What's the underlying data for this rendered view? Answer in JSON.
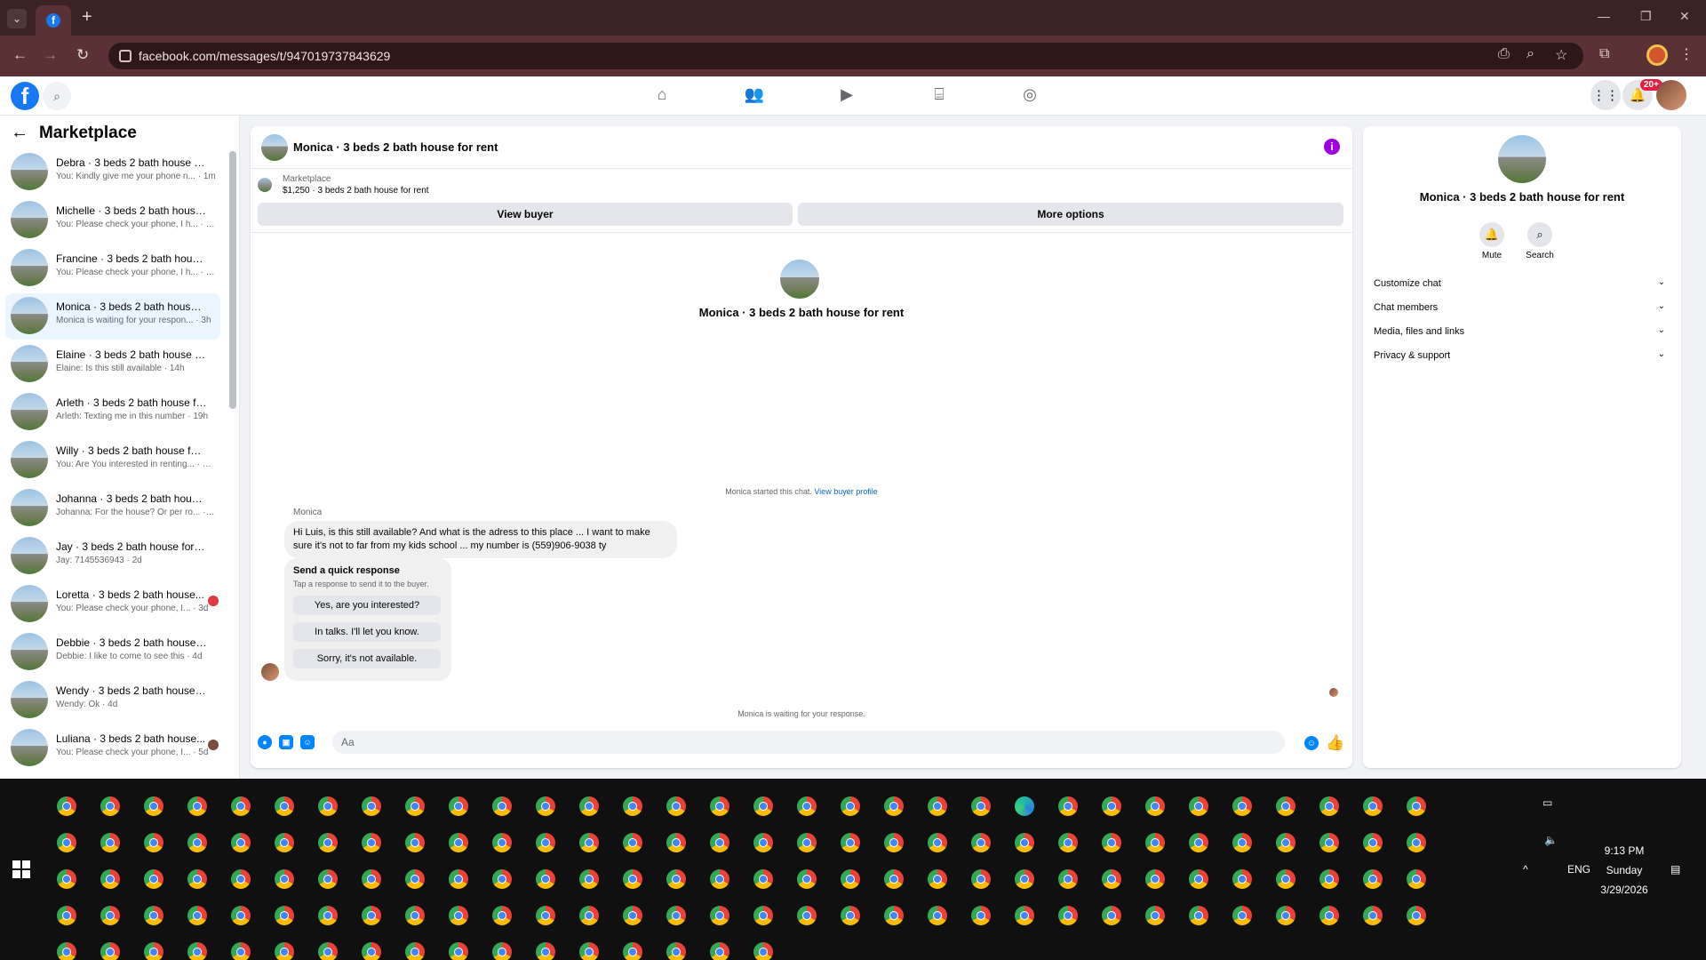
{
  "browser": {
    "url": "facebook.com/messages/t/947019737843629",
    "controls": {
      "minimize": "—",
      "restore": "❐",
      "close": "✕"
    }
  },
  "sidebar": {
    "title": "Marketplace",
    "conversations": [
      {
        "title": "Debra · 3 beds 2 bath house for...",
        "subtitle": "You: Kindly give me your phone n... · 1m"
      },
      {
        "title": "Michelle · 3 beds 2 bath house ...",
        "subtitle": "You: Please check your phone, I h... · 1m"
      },
      {
        "title": "Francine · 3 beds 2 bath house ...",
        "subtitle": "You: Please check your phone, I h... · 1m"
      },
      {
        "title": "Monica · 3 beds 2 bath house f...",
        "subtitle": "Monica is waiting for your respon... · 3h"
      },
      {
        "title": "Elaine · 3 beds 2 bath house for...",
        "subtitle": "Elaine: Is this still available · 14h"
      },
      {
        "title": "Arleth · 3 beds 2 bath house for...",
        "subtitle": "Arleth: Texting me in this number · 19h"
      },
      {
        "title": "Willy · 3 beds 2 bath house for ...",
        "subtitle": "You: Are You interested in renting... · 19h"
      },
      {
        "title": "Johanna · 3 beds 2 bath house f...",
        "subtitle": "Johanna: For the house? Or per ro... · 1d"
      },
      {
        "title": "Jay · 3 beds 2 bath house for rent",
        "subtitle": "Jay: 7145536943 · 2d"
      },
      {
        "title": "Loretta · 3 beds 2 bath house...",
        "subtitle": "You: Please check your phone, I... · 3d"
      },
      {
        "title": "Debbie · 3 beds 2 bath house f...",
        "subtitle": "Debbie: I like to come to see this · 4d"
      },
      {
        "title": "Wendy · 3 beds 2 bath house fo...",
        "subtitle": "Wendy: Ok · 4d"
      },
      {
        "title": "Luliana · 3 beds 2 bath house...",
        "subtitle": "You: Please check your phone, I... · 5d"
      }
    ]
  },
  "chat": {
    "title": "Monica · 3 beds 2 bath house for rent",
    "marketplace_label": "Marketplace",
    "listing": "$1,250 · 3 beds 2 bath house for rent",
    "view_buyer": "View buyer",
    "more_options": "More options",
    "hero_name": "Monica · 3 beds 2 bath house for rent",
    "started_text": "Monica started this chat.",
    "view_profile": "View buyer profile",
    "sender": "Monica",
    "message": "Hi Luis, is this still available?  And what is the adress to this place ... I want to make sure it's not to far from my kids school ... my number is (559)906-9038 ty",
    "quick_title": "Send a quick response",
    "quick_sub": "Tap a response to send it to the buyer.",
    "quick_responses": [
      "Yes, are you interested?",
      "In talks. I'll let you know.",
      "Sorry, it's not available."
    ],
    "waiting": "Monica is waiting for your response.",
    "placeholder": "Aa"
  },
  "info_panel": {
    "name": "Monica · 3 beds 2 bath house for rent",
    "mute": "Mute",
    "search": "Search",
    "rows": [
      "Customize chat",
      "Chat members",
      "Media, files and links",
      "Privacy & support"
    ]
  },
  "fb": {
    "notification_count": "20+"
  },
  "taskbar": {
    "language": "ENG",
    "time": "9:13 PM",
    "day": "Sunday",
    "date": "3/29/2026"
  }
}
